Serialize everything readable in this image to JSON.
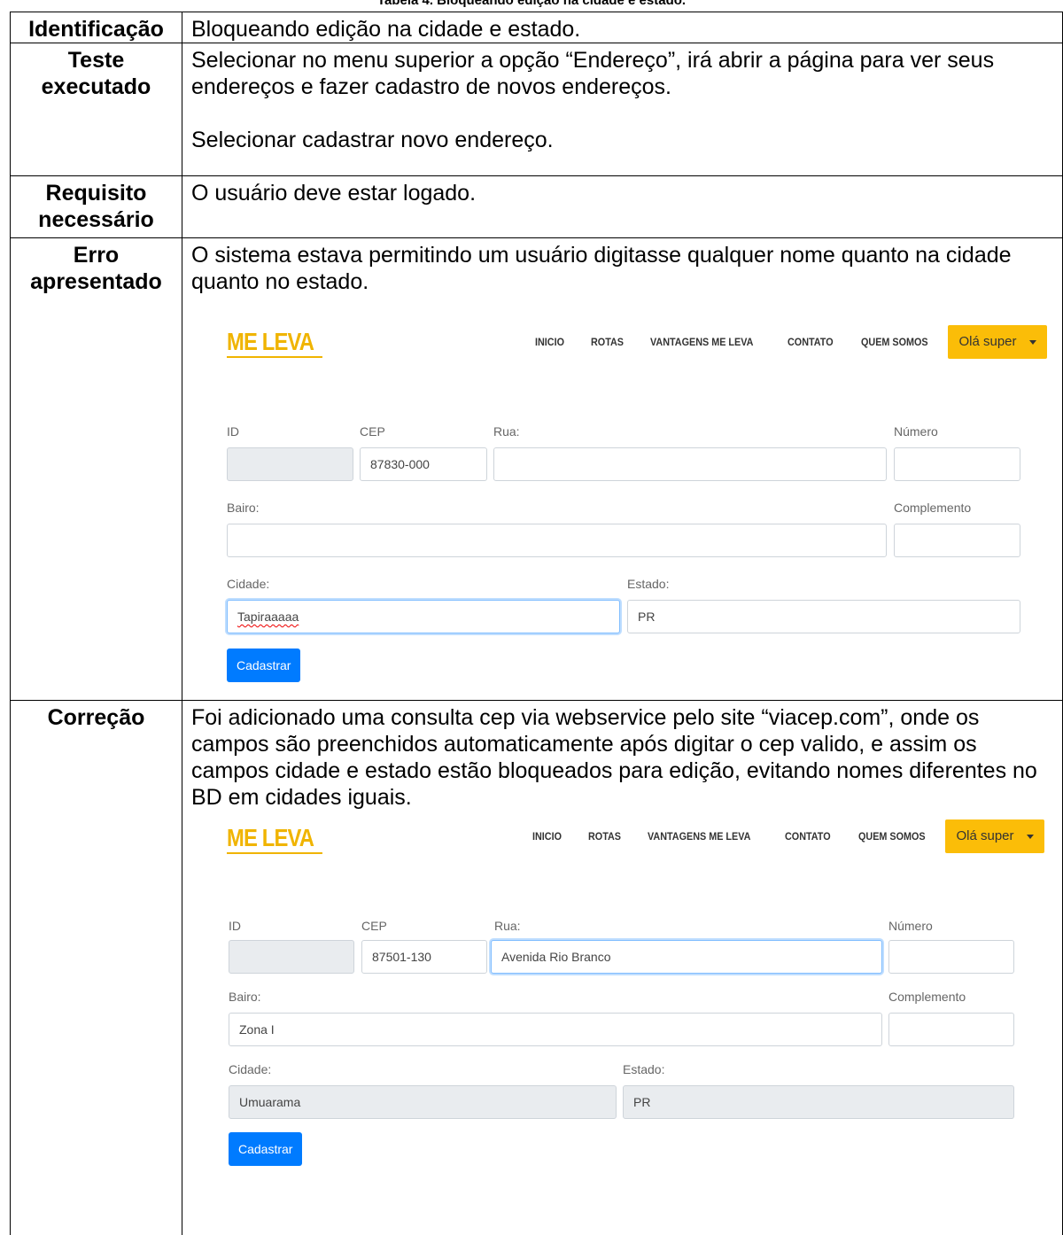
{
  "caption": "Tabela 4. Bloqueando edição na cidade e estado.",
  "rows": {
    "identificacao": {
      "label": "Identificação",
      "text": "Bloqueando edição na cidade e estado."
    },
    "teste": {
      "label": "Teste executado",
      "p1": "Selecionar no menu superior a opção “Endereço”, irá abrir a página para ver seus endereços e fazer cadastro de novos endereços.",
      "p2": "Selecionar cadastrar novo endereço."
    },
    "requisito": {
      "label": "Requisito necessário",
      "text": "O usuário deve estar logado."
    },
    "erro": {
      "label": "Erro apresentado",
      "text": "O sistema estava permitindo um usuário digitasse qualquer nome quanto na cidade quanto no estado."
    },
    "correcao": {
      "label": "Correção",
      "text": "Foi adicionado uma consulta cep via webservice pelo site “viacep.com”, onde os campos são preenchidos automaticamente após digitar o cep valido, e assim os campos cidade e estado estão bloqueados para edição, evitando nomes diferentes no BD em cidades iguais."
    }
  },
  "app": {
    "logo": "ME LEVA",
    "nav": [
      "INICIO",
      "ROTAS",
      "VANTAGENS ME LEVA",
      "CONTATO",
      "QUEM SOMOS"
    ],
    "user_menu": "Olá super",
    "labels": {
      "id": "ID",
      "cep": "CEP",
      "rua": "Rua:",
      "numero": "Número",
      "bairro": "Bairo:",
      "complemento": "Complemento",
      "cidade": "Cidade:",
      "estado": "Estado:"
    },
    "submit": "Cadastrar"
  },
  "form_before": {
    "id": "",
    "cep": "87830-000",
    "rua": "",
    "numero": "",
    "bairro": "",
    "complemento": "",
    "cidade": "Tapiraaaaa",
    "estado": "PR"
  },
  "form_after": {
    "id": "",
    "cep": "87501-130",
    "rua": "Avenida Rio Branco",
    "numero": "",
    "bairro": "Zona I",
    "complemento": "",
    "cidade": "Umuarama",
    "estado": "PR"
  },
  "colors": {
    "brand_yellow": "#f0b400",
    "user_button": "#fbbd08",
    "primary_button": "#007bff",
    "disabled_input": "#e9ecef"
  }
}
